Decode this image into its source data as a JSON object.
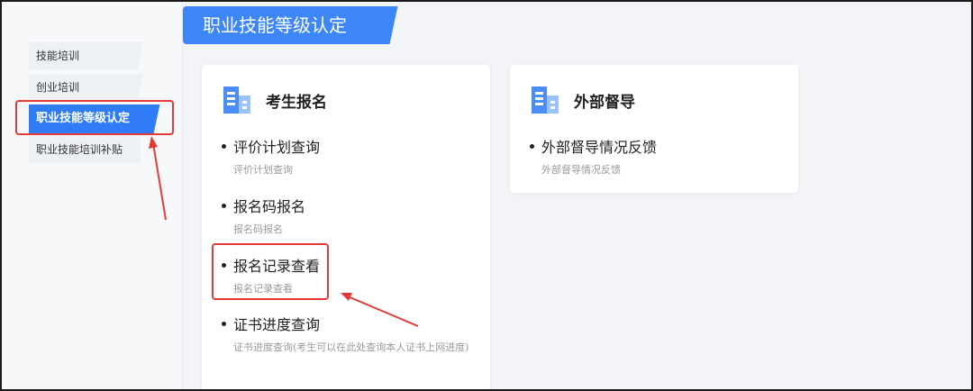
{
  "sidebar": {
    "items": [
      {
        "label": "技能培训"
      },
      {
        "label": "创业培训"
      },
      {
        "label": "职业技能等级认定"
      },
      {
        "label": "职业技能培训补贴"
      }
    ]
  },
  "main": {
    "tab_title": "职业技能等级认定",
    "cards": [
      {
        "title": "考生报名",
        "icon": "building-icon",
        "entries": [
          {
            "title": "评价计划查询",
            "subtitle": "评价计划查询"
          },
          {
            "title": "报名码报名",
            "subtitle": "报名码报名"
          },
          {
            "title": "报名记录查看",
            "subtitle": "报名记录查看"
          },
          {
            "title": "证书进度查询",
            "subtitle": "证书进度查询(考生可以在此处查询本人证书上网进度)"
          }
        ]
      },
      {
        "title": "外部督导",
        "icon": "building-icon",
        "entries": [
          {
            "title": "外部督导情况反馈",
            "subtitle": "外部督导情况反馈"
          }
        ]
      }
    ]
  },
  "colors": {
    "accent": "#3d86f8",
    "highlight": "#e53935"
  }
}
